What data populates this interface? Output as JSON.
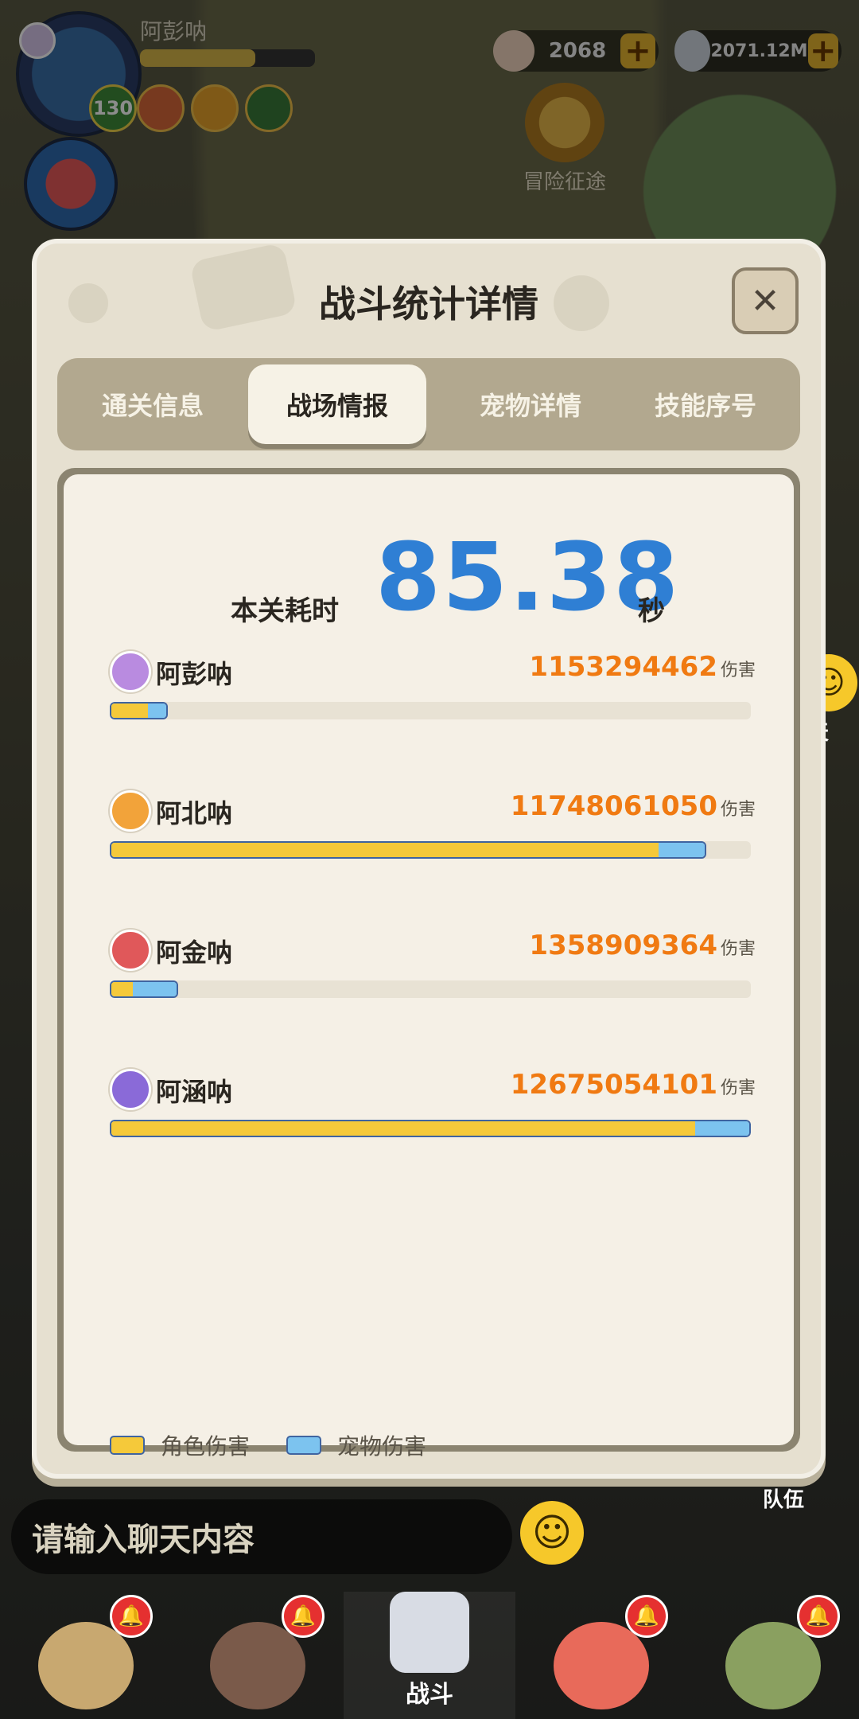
{
  "player": {
    "name": "阿彭呐",
    "level": "130"
  },
  "resources": [
    {
      "id": "gem",
      "value": "2068"
    },
    {
      "id": "coin",
      "value": "2071.12M"
    }
  ],
  "adventure": {
    "label": "冒险征途"
  },
  "chat_float": {
    "label": "聊天"
  },
  "team_float": {
    "label": "队伍"
  },
  "chat_input": {
    "placeholder": "请输入聊天内容"
  },
  "bottom_nav": {
    "battle_label": "战斗"
  },
  "modal": {
    "title": "战斗统计详情",
    "tabs": [
      {
        "label": "通关信息",
        "active": false
      },
      {
        "label": "战场情报",
        "active": true
      },
      {
        "label": "宠物详情",
        "active": false
      },
      {
        "label": "技能序号",
        "active": false
      }
    ],
    "time_label": "本关耗时",
    "time_value": "85.38",
    "time_unit": "秒",
    "damage_unit": "伤害",
    "players": [
      {
        "name": "阿彭呐",
        "damage": "1153294462",
        "role_fraction": 0.057,
        "pet_fraction": 0.033,
        "icon_color": "#b98be0"
      },
      {
        "name": "阿北呐",
        "damage": "11748061050",
        "role_fraction": 0.853,
        "pet_fraction": 0.077,
        "icon_color": "#f2a33a"
      },
      {
        "name": "阿金呐",
        "damage": "1358909364",
        "role_fraction": 0.033,
        "pet_fraction": 0.074,
        "icon_color": "#e0585a"
      },
      {
        "name": "阿涵呐",
        "damage": "12675054101",
        "role_fraction": 0.911,
        "pet_fraction": 0.089,
        "icon_color": "#8a6ad8"
      }
    ],
    "legend": {
      "role": "角色伤害",
      "pet": "宠物伤害"
    }
  },
  "colors": {
    "accent_blue": "#2f7fd4",
    "damage_orange": "#f07a12",
    "role_bar": "#f5c93a",
    "pet_bar": "#7cc3ef"
  }
}
